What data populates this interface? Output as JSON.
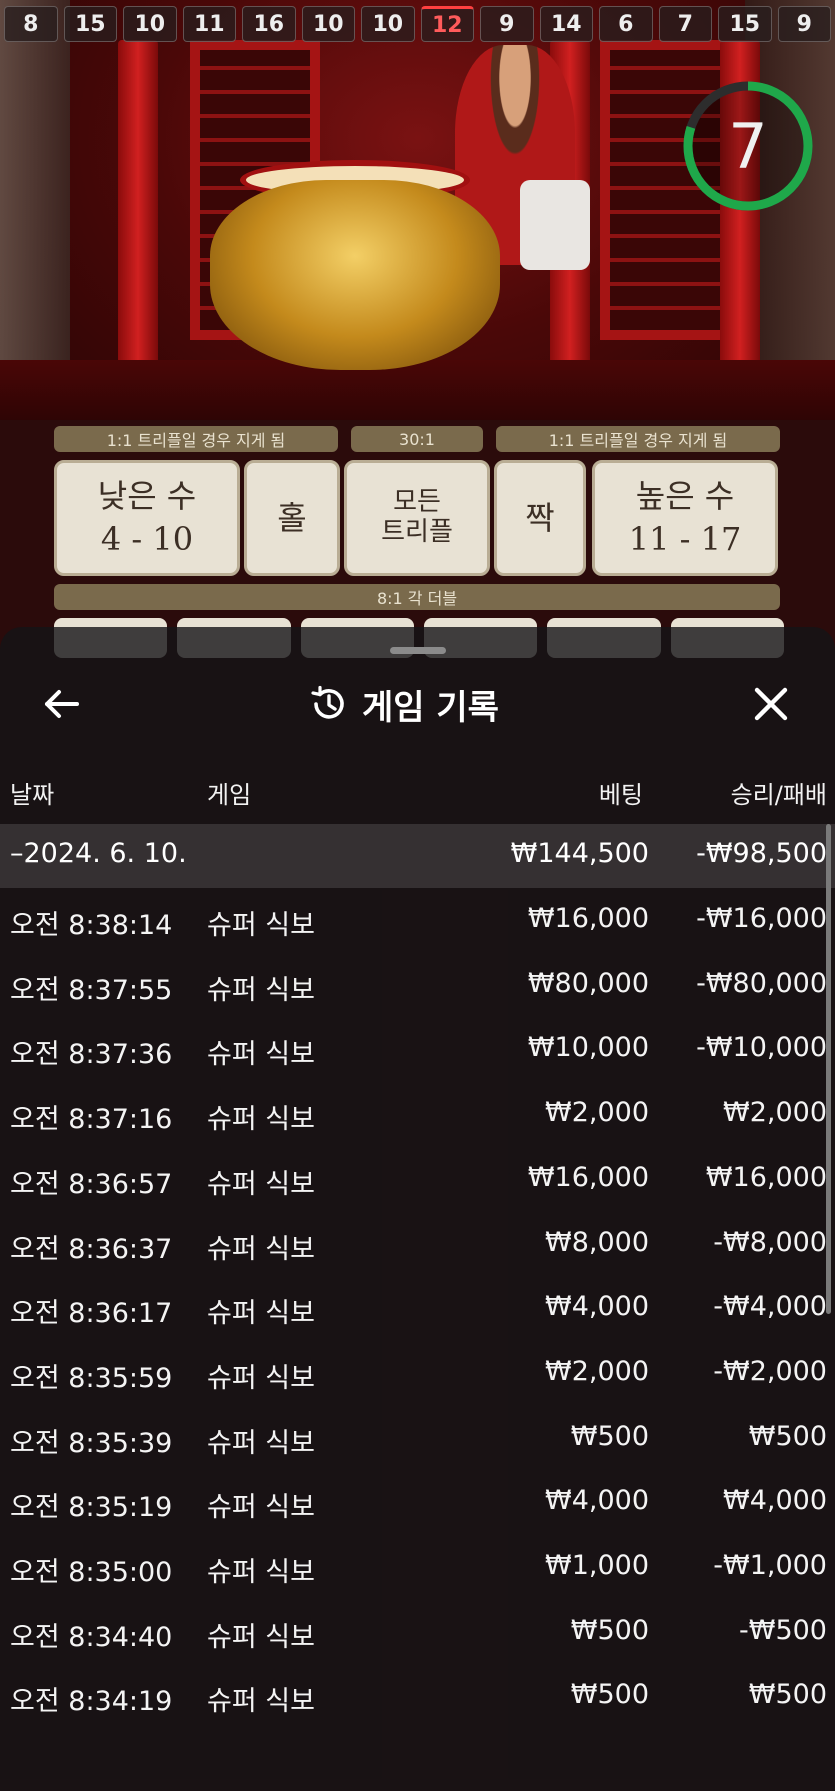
{
  "results": [
    "8",
    "15",
    "10",
    "11",
    "16",
    "10",
    "10",
    "12",
    "9",
    "14",
    "6",
    "7",
    "15",
    "9"
  ],
  "timer": {
    "value": "7",
    "progress": 0.8
  },
  "board": {
    "pay_small": "1:1 트리플일 경우 지게 됨",
    "pay_triple": "30:1",
    "pay_big": "1:1 트리플일 경우 지게 됨",
    "small_label": "낮은 수",
    "small_range": "4 - 10",
    "odd_label": "홀",
    "any_triple_label_1": "모든",
    "any_triple_label_2": "트리플",
    "even_label": "짝",
    "big_label": "높은 수",
    "big_range": "11 - 17",
    "pay_double": "8:1 각 더블"
  },
  "sheet": {
    "title": "게임 기록",
    "columns": {
      "date": "날짜",
      "game": "게임",
      "bet": "베팅",
      "result": "승리/패배"
    },
    "summary": {
      "date": "–2024. 6. 10.",
      "bet": "₩144,500",
      "result": "-₩98,500"
    },
    "rows": [
      {
        "time": "오전 8:38:14",
        "game": "슈퍼 식보",
        "bet": "₩16,000",
        "result": "-₩16,000"
      },
      {
        "time": "오전 8:37:55",
        "game": "슈퍼 식보",
        "bet": "₩80,000",
        "result": "-₩80,000"
      },
      {
        "time": "오전 8:37:36",
        "game": "슈퍼 식보",
        "bet": "₩10,000",
        "result": "-₩10,000"
      },
      {
        "time": "오전 8:37:16",
        "game": "슈퍼 식보",
        "bet": "₩2,000",
        "result": "₩2,000"
      },
      {
        "time": "오전 8:36:57",
        "game": "슈퍼 식보",
        "bet": "₩16,000",
        "result": "₩16,000"
      },
      {
        "time": "오전 8:36:37",
        "game": "슈퍼 식보",
        "bet": "₩8,000",
        "result": "-₩8,000"
      },
      {
        "time": "오전 8:36:17",
        "game": "슈퍼 식보",
        "bet": "₩4,000",
        "result": "-₩4,000"
      },
      {
        "time": "오전 8:35:59",
        "game": "슈퍼 식보",
        "bet": "₩2,000",
        "result": "-₩2,000"
      },
      {
        "time": "오전 8:35:39",
        "game": "슈퍼 식보",
        "bet": "₩500",
        "result": "₩500"
      },
      {
        "time": "오전 8:35:19",
        "game": "슈퍼 식보",
        "bet": "₩4,000",
        "result": "₩4,000"
      },
      {
        "time": "오전 8:35:00",
        "game": "슈퍼 식보",
        "bet": "₩1,000",
        "result": "-₩1,000"
      },
      {
        "time": "오전 8:34:40",
        "game": "슈퍼 식보",
        "bet": "₩500",
        "result": "-₩500"
      },
      {
        "time": "오전 8:34:19",
        "game": "슈퍼 식보",
        "bet": "₩500",
        "result": "₩500"
      }
    ]
  },
  "colors": {
    "timer_ring": "#1fa84a",
    "hot_result": "#ff4040",
    "sheet_bg": "#141416"
  }
}
